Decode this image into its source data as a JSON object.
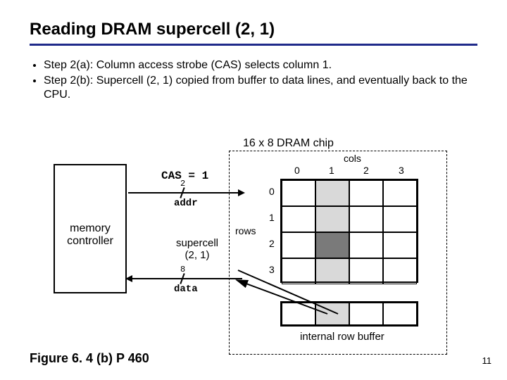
{
  "title": "Reading DRAM supercell (2, 1)",
  "bullets": [
    "Step 2(a): Column access strobe (CAS) selects column 1.",
    "Step 2(b): Supercell (2, 1) copied from buffer to data lines, and eventually back to the CPU."
  ],
  "chip_label": "16 x 8 DRAM chip",
  "mem_controller": "memory\ncontroller",
  "cas": "CAS = 1",
  "addr": {
    "width": "2",
    "label": "addr"
  },
  "data": {
    "width": "8",
    "label": "data"
  },
  "supercell": {
    "line1": "supercell",
    "line2": "(2, 1)"
  },
  "cols_label": "cols",
  "rows_label": "rows",
  "col_nums": [
    "0",
    "1",
    "2",
    "3"
  ],
  "row_nums": [
    "0",
    "1",
    "2",
    "3"
  ],
  "row_buffer_label": "internal row buffer",
  "figure_ref": "Figure 6. 4 (b)  P 460",
  "page_num": "11",
  "chart_data": {
    "type": "table",
    "grid_rows": 4,
    "grid_cols": 4,
    "selected_column": 1,
    "selected_supercell": [
      2,
      1
    ],
    "row_buffer_loaded": true,
    "row_buffer_selected_col": 1
  }
}
